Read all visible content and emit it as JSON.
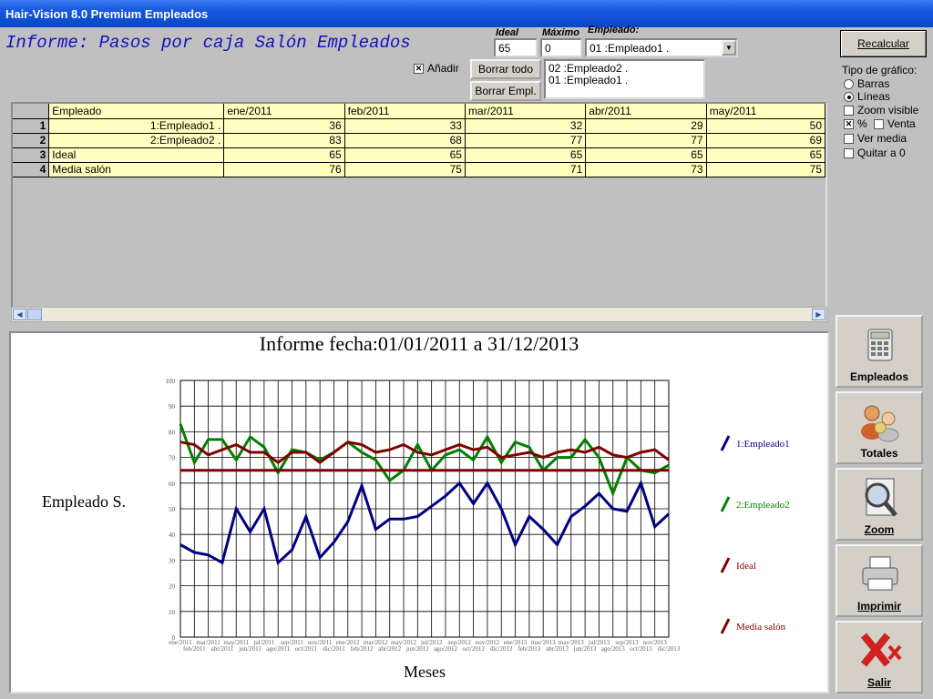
{
  "window": {
    "title": "Hair-Vision 8.0 Premium Empleados"
  },
  "header": {
    "report_title": "Informe: Pasos por caja Salón Empleados",
    "ideal_label": "Ideal",
    "ideal_value": "65",
    "maximo_label": "Máximo",
    "maximo_value": "0",
    "empleado_label": "Empleado:",
    "empleado_selected": "01 :Empleado1 .",
    "anadir_label": "Añadir",
    "anadir_checked": true,
    "borrar_todo": "Borrar todo",
    "borrar_empl": "Borrar Empl.",
    "selected_list": [
      "02 :Empleado2 .",
      "01 :Empleado1 ."
    ]
  },
  "options": {
    "recalcular": "Recalcular",
    "tipo_label": "Tipo de gráfico:",
    "barras": "Barras",
    "lineas": "Líneas",
    "tipo_selected": "Líneas",
    "zoom_visible": "Zoom visible",
    "pct": "%",
    "venta": "Venta",
    "ver_media": "Ver media",
    "quitar_0": "Quitar a 0"
  },
  "table": {
    "columns": [
      "Empleado",
      "ene/2011",
      "feb/2011",
      "mar/2011",
      "abr/2011",
      "may/2011"
    ],
    "rows": [
      {
        "n": "1",
        "name": "1:Empleado1 .",
        "values": [
          "36",
          "33",
          "32",
          "29",
          "50"
        ]
      },
      {
        "n": "2",
        "name": "2:Empleado2 .",
        "values": [
          "83",
          "68",
          "77",
          "77",
          "69"
        ]
      },
      {
        "n": "3",
        "name": "Ideal",
        "values": [
          "65",
          "65",
          "65",
          "65",
          "65"
        ]
      },
      {
        "n": "4",
        "name": "Media salón",
        "values": [
          "76",
          "75",
          "71",
          "73",
          "75"
        ]
      }
    ]
  },
  "side_buttons": [
    {
      "label": "Empleados",
      "icon": "calculator-icon"
    },
    {
      "label": "Totales",
      "icon": "people-icon"
    },
    {
      "label": "Zoom",
      "icon": "magnifier-icon"
    },
    {
      "label": "Imprimir",
      "icon": "printer-icon"
    },
    {
      "label": "Salir",
      "icon": "exit-icon"
    }
  ],
  "chart_data": {
    "type": "line",
    "title": "Informe fecha:01/01/2011 a 31/12/2013",
    "xlabel": "Meses",
    "ylabel": "Empleado S.",
    "ylim": [
      0,
      100
    ],
    "yticks": [
      0,
      10,
      20,
      30,
      40,
      50,
      60,
      70,
      80,
      90,
      100
    ],
    "grid": true,
    "legend_position": "right",
    "categories": [
      "ene/2011",
      "feb/2011",
      "mar/2011",
      "abr/2011",
      "may/2011",
      "jun/2011",
      "jul/2011",
      "ago/2011",
      "sep/2011",
      "oct/2011",
      "nov/2011",
      "dic/2011",
      "ene/2012",
      "feb/2012",
      "mar/2012",
      "abr/2012",
      "may/2012",
      "jun/2012",
      "jul/2012",
      "ago/2012",
      "sep/2012",
      "oct/2012",
      "nov/2012",
      "dic/2012",
      "ene/2013",
      "feb/2013",
      "mar/2013",
      "abr/2013",
      "may/2013",
      "jun/2013",
      "jul/2013",
      "ago/2013",
      "sep/2013",
      "oct/2013",
      "nov/2013",
      "dic/2013"
    ],
    "series": [
      {
        "name": "1:Empleado1",
        "color": "#000080",
        "values": [
          36,
          33,
          32,
          29,
          50,
          41,
          50,
          29,
          34,
          47,
          31,
          37,
          45,
          59,
          42,
          46,
          46,
          47,
          51,
          55,
          60,
          52,
          60,
          50,
          36,
          47,
          42,
          36,
          47,
          51,
          56,
          50,
          49,
          60,
          43,
          48
        ]
      },
      {
        "name": "2:Empleado2",
        "color": "#008000",
        "values": [
          83,
          68,
          77,
          77,
          69,
          78,
          74,
          64,
          73,
          72,
          69,
          72,
          76,
          72,
          69,
          61,
          65,
          75,
          65,
          71,
          73,
          69,
          78,
          68,
          76,
          74,
          65,
          70,
          70,
          77,
          70,
          56,
          70,
          65,
          64,
          67
        ]
      },
      {
        "name": "Ideal",
        "color": "#800000",
        "values": [
          65,
          65,
          65,
          65,
          65,
          65,
          65,
          65,
          65,
          65,
          65,
          65,
          65,
          65,
          65,
          65,
          65,
          65,
          65,
          65,
          65,
          65,
          65,
          65,
          65,
          65,
          65,
          65,
          65,
          65,
          65,
          65,
          65,
          65,
          65,
          65
        ]
      },
      {
        "name": "Media salón",
        "color": "#800000",
        "values": [
          76,
          75,
          71,
          73,
          75,
          72,
          72,
          68,
          72,
          72,
          68,
          72,
          76,
          75,
          72,
          73,
          75,
          72,
          71,
          73,
          75,
          73,
          74,
          70,
          71,
          72,
          70,
          72,
          73,
          72,
          74,
          71,
          70,
          72,
          73,
          69
        ]
      }
    ]
  }
}
